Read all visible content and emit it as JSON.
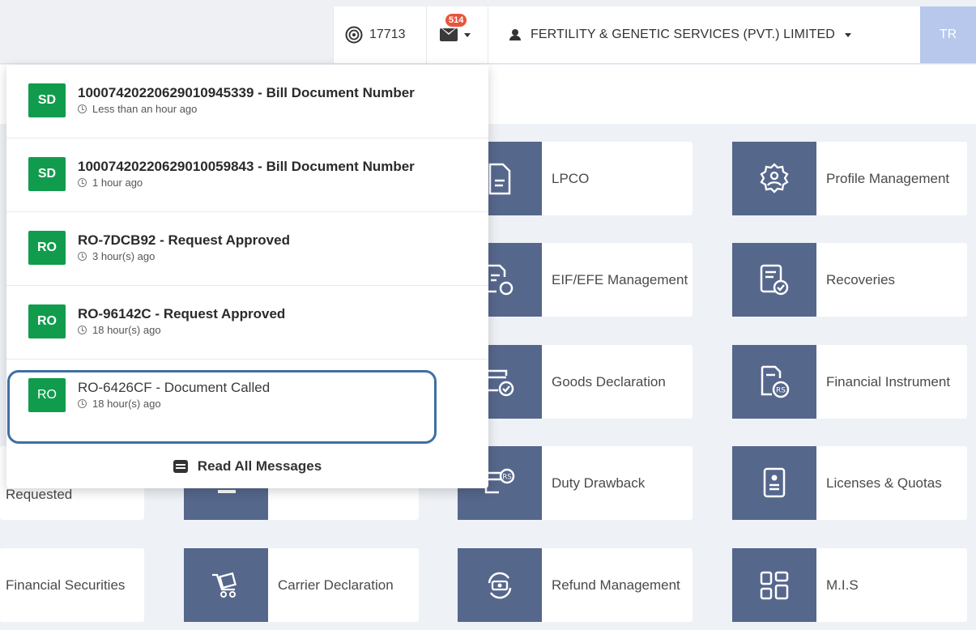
{
  "topbar": {
    "coins": "17713",
    "mail_badge": "514",
    "company": "FERTILITY & GENETIC SERVICES (PVT.) LIMITED",
    "avatar": "TR"
  },
  "tiles": [
    {
      "id": "lpco",
      "label": "LPCO"
    },
    {
      "id": "profile",
      "label": "Profile Management"
    },
    {
      "id": "eif",
      "label": "EIF/EFE Management"
    },
    {
      "id": "recoveries",
      "label": "Recoveries"
    },
    {
      "id": "goods",
      "label": "Goods Declaration"
    },
    {
      "id": "financial-instrument",
      "label": "Financial Instrument"
    },
    {
      "id": "duty",
      "label": "Duty Drawback"
    },
    {
      "id": "licenses",
      "label": "Licenses & Quotas"
    },
    {
      "id": "carrier",
      "label": "Carrier Declaration"
    },
    {
      "id": "refund",
      "label": "Refund Management"
    },
    {
      "id": "mis",
      "label": "M.I.S"
    }
  ],
  "partial_tiles": {
    "requested": "Requested",
    "financial_securities": "Financial Securities"
  },
  "notifications": [
    {
      "tag": "SD",
      "title": "1000742022062901094533​9 - Bill Document Number",
      "time": "Less than an hour ago"
    },
    {
      "tag": "SD",
      "title": "10007420220629010059843 - Bill Document Number",
      "time": "1 hour ago"
    },
    {
      "tag": "RO",
      "title": "RO-7DCB92 - Request Approved",
      "time": "3 hour(s) ago"
    },
    {
      "tag": "RO",
      "title": "RO-96142C - Request Approved",
      "time": "18 hour(s) ago"
    },
    {
      "tag": "RO",
      "title": "RO-6426CF - Document Called",
      "time": "18 hour(s) ago"
    }
  ],
  "read_all": "Read All Messages"
}
